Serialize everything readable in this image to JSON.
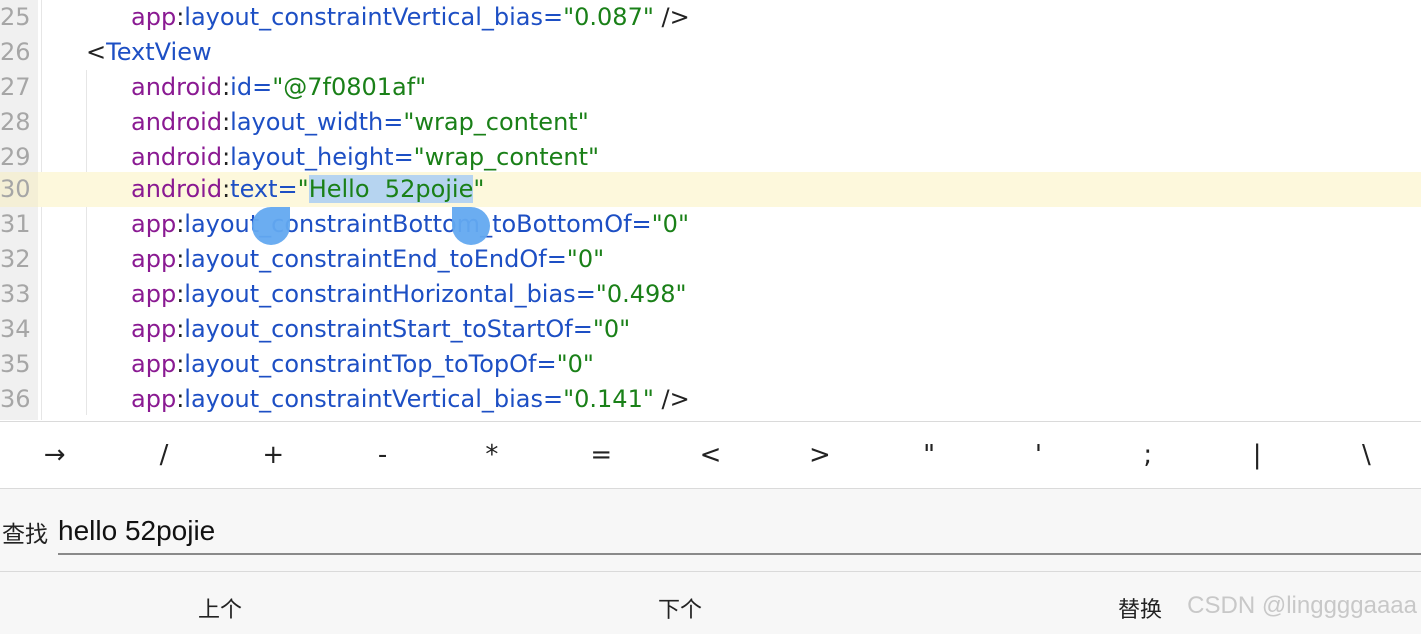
{
  "editor": {
    "lines": [
      {
        "num": "25",
        "ns": "app",
        "attr": "layout_constraintVertical_bias",
        "eq": "=",
        "val": "\"0.087\"",
        "tail": " />"
      },
      {
        "num": "26",
        "open": "<",
        "tag": "TextView"
      },
      {
        "num": "27",
        "ns": "android",
        "attr": "id",
        "eq": "=",
        "val": "\"@7f0801af\""
      },
      {
        "num": "28",
        "ns": "android",
        "attr": "layout_width",
        "eq": "=",
        "val": "\"wrap_content\""
      },
      {
        "num": "29",
        "ns": "android",
        "attr": "layout_height",
        "eq": "=",
        "val": "\"wrap_content\""
      },
      {
        "num": "30",
        "ns": "android",
        "attr": "text",
        "eq": "=",
        "q1": "\"",
        "selected": "Hello  52pojie",
        "q2": "\""
      },
      {
        "num": "31",
        "ns": "app",
        "attr": "layout_constraintBottom_toBottomOf",
        "eq": "=",
        "val": "\"0\""
      },
      {
        "num": "32",
        "ns": "app",
        "attr": "layout_constraintEnd_toEndOf",
        "eq": "=",
        "val": "\"0\""
      },
      {
        "num": "33",
        "ns": "app",
        "attr": "layout_constraintHorizontal_bias",
        "eq": "=",
        "val": "\"0.498\""
      },
      {
        "num": "34",
        "ns": "app",
        "attr": "layout_constraintStart_toStartOf",
        "eq": "=",
        "val": "\"0\""
      },
      {
        "num": "35",
        "ns": "app",
        "attr": "layout_constraintTop_toTopOf",
        "eq": "=",
        "val": "\"0\""
      },
      {
        "num": "36",
        "ns": "app",
        "attr": "layout_constraintVertical_bias",
        "eq": "=",
        "val": "\"0.141\"",
        "tail": " />"
      }
    ]
  },
  "symbols": [
    "→",
    "/",
    "+",
    "-",
    "*",
    "=",
    "<",
    ">",
    "\"",
    "'",
    ";",
    "|",
    "\\"
  ],
  "find": {
    "label": "查找",
    "value": "hello 52pojie"
  },
  "actions": {
    "prev": "上个",
    "next": "下个",
    "replace": "替换"
  },
  "watermark": "CSDN @linggggaaaa",
  "colors": {
    "namespace": "#8a1a92",
    "attribute": "#1d4fc4",
    "value": "#1a8018",
    "current_line": "#fdf8dc",
    "selection": "#b6d4f0",
    "handle": "#63a9f0"
  }
}
